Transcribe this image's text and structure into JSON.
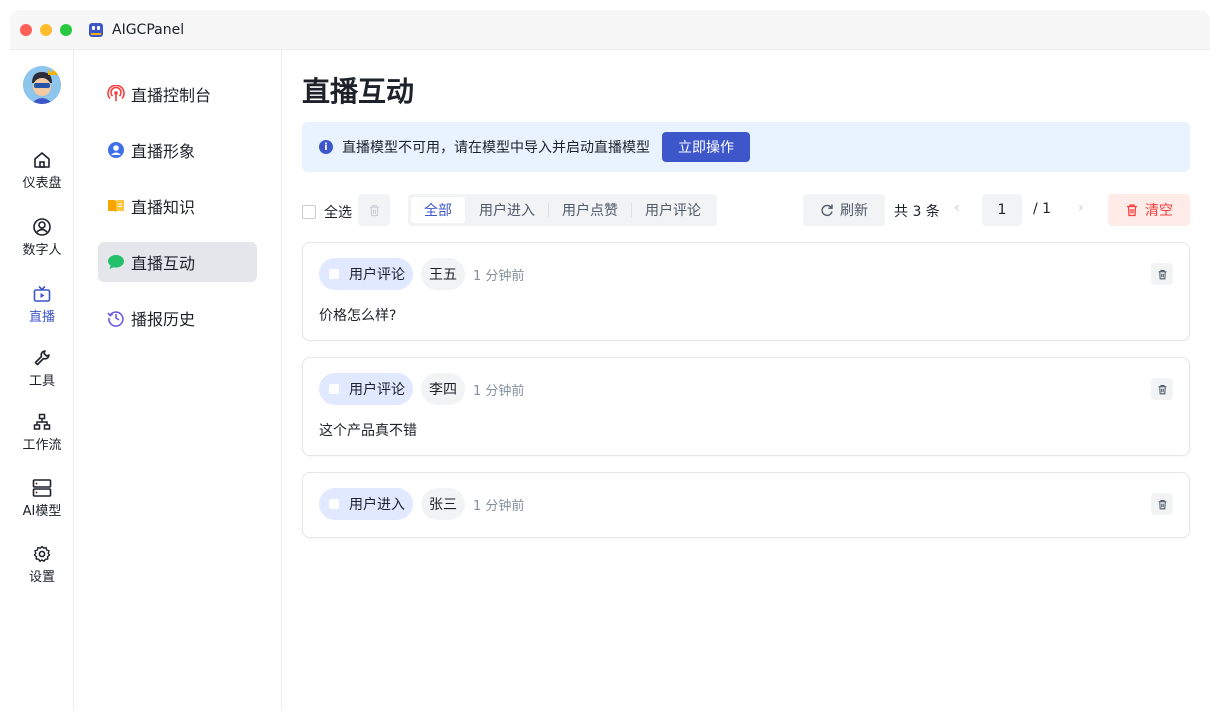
{
  "app": {
    "title": "AIGCPanel"
  },
  "rail": {
    "items": [
      {
        "label": "仪表盘",
        "icon": "home-icon"
      },
      {
        "label": "数字人",
        "icon": "user-circle-icon"
      },
      {
        "label": "直播",
        "icon": "tv-icon",
        "active": true
      },
      {
        "label": "工具",
        "icon": "wrench-icon"
      },
      {
        "label": "工作流",
        "icon": "sitemap-icon"
      },
      {
        "label": "AI模型",
        "icon": "server-icon"
      },
      {
        "label": "设置",
        "icon": "gear-icon"
      }
    ]
  },
  "subnav": {
    "items": [
      {
        "label": "直播控制台",
        "icon": "broadcast-icon"
      },
      {
        "label": "直播形象",
        "icon": "profile-icon"
      },
      {
        "label": "直播知识",
        "icon": "book-icon"
      },
      {
        "label": "直播互动",
        "icon": "chat-icon",
        "active": true
      },
      {
        "label": "播报历史",
        "icon": "history-icon"
      }
    ]
  },
  "page": {
    "title": "直播互动"
  },
  "alert": {
    "text": "直播模型不可用，请在模型中导入并启动直播模型",
    "action": "立即操作",
    "icon_glyph": "i"
  },
  "toolbar": {
    "select_all": "全选",
    "tabs": [
      "全部",
      "用户进入",
      "用户点赞",
      "用户评论"
    ],
    "active_tab": "全部",
    "refresh": "刷新",
    "total": "共 3 条",
    "prev": "‹",
    "next": "›",
    "page": "1",
    "page_total": "/ 1",
    "clear": "清空"
  },
  "events": [
    {
      "type": "用户评论",
      "user": "王五",
      "time": "1 分钟前",
      "content": "价格怎么样?"
    },
    {
      "type": "用户评论",
      "user": "李四",
      "time": "1 分钟前",
      "content": "这个产品真不错"
    },
    {
      "type": "用户进入",
      "user": "张三",
      "time": "1 分钟前",
      "content": ""
    }
  ],
  "colors": {
    "accent": "#3d56c9",
    "alert_bg": "#e8f3ff",
    "danger": "#f53f3f",
    "danger_bg": "#ffece8",
    "type_pill_bg": "#e0e9ff"
  }
}
